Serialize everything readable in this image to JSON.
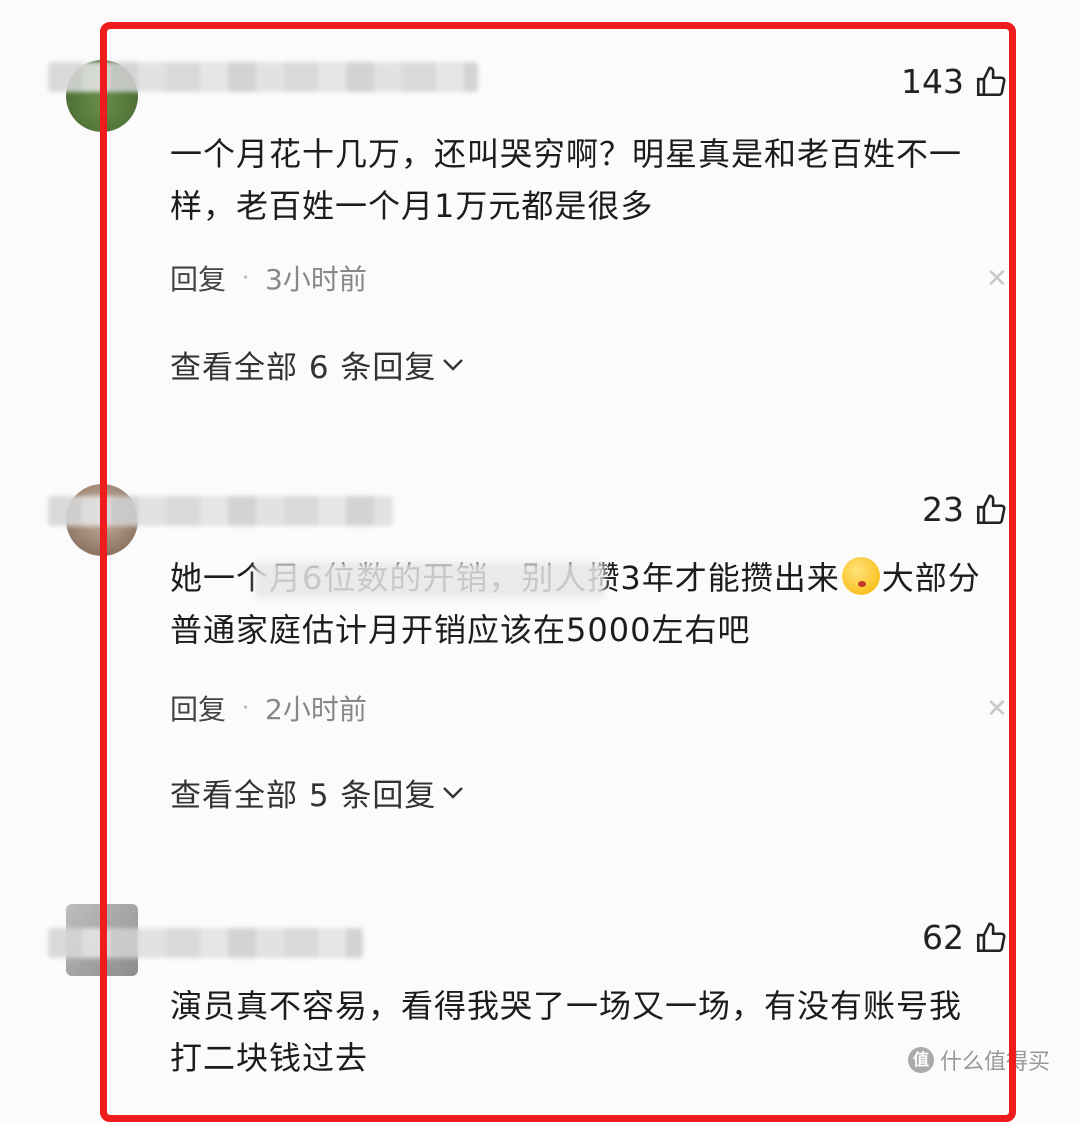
{
  "comments": [
    {
      "likes": "143",
      "text": "一个月花十几万，还叫哭穷啊？明星真是和老百姓不一样，老百姓一个月1万元都是很多",
      "reply_label": "回复",
      "time": "3小时前",
      "view_all": "查看全部 6 条回复"
    },
    {
      "likes": "23",
      "text_before": "她一个月6位数的开销，别人攒3年才能攒出来",
      "text_after": "大部分普通家庭估计月开销应该在5000左右吧",
      "emoji": "kissing-face",
      "reply_label": "回复",
      "time": "2小时前",
      "view_all": "查看全部 5 条回复"
    },
    {
      "likes": "62",
      "text": "演员真不容易，看得我哭了一场又一场，有没有账号我打二块钱过去"
    }
  ],
  "watermark": "什么值得买",
  "colors": {
    "frame": "#ee1c1c",
    "text": "#1c1c1c",
    "muted": "#888888"
  }
}
